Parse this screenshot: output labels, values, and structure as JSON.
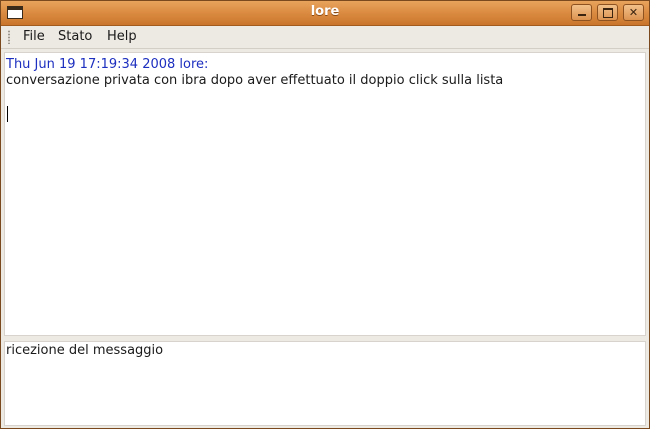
{
  "window": {
    "title": "lore"
  },
  "menu": {
    "items": [
      "File",
      "Stato",
      "Help"
    ]
  },
  "chat": {
    "header": "Thu Jun 19 17:19:34 2008 lore:",
    "message": "conversazione privata con ibra dopo aver effettuato il doppio click sulla lista"
  },
  "status": {
    "text": "ricezione del messaggio"
  },
  "colors": {
    "titlebar": "#d9893e",
    "timestamp": "#1d2fbf"
  }
}
